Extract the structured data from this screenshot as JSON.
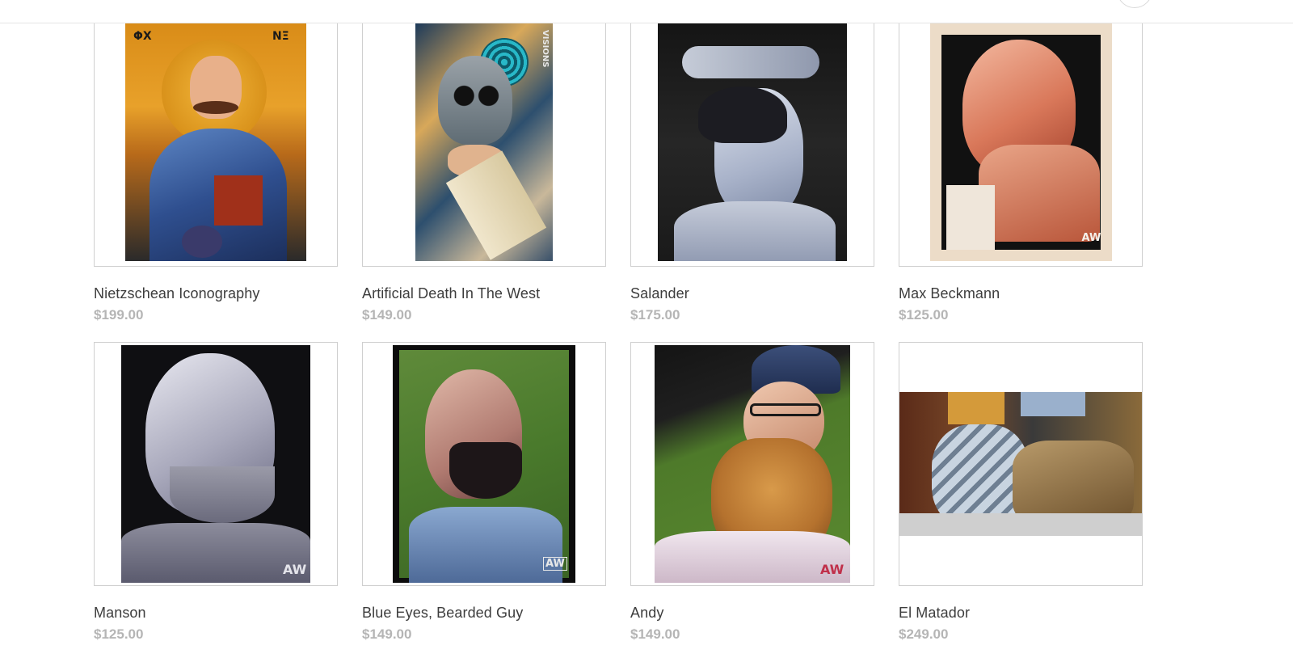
{
  "products": [
    {
      "title": "Nietzschean Iconography",
      "price": "$199.00",
      "image": "portrait-icon-painting"
    },
    {
      "title": "Artificial Death In The West",
      "price": "$149.00",
      "image": "skull-collage"
    },
    {
      "title": "Salander",
      "price": "$175.00",
      "image": "figure-painting"
    },
    {
      "title": "Max Beckmann",
      "price": "$125.00",
      "image": "portrait-painting"
    },
    {
      "title": "Manson",
      "price": "$125.00",
      "image": "portrait-painting"
    },
    {
      "title": "Blue Eyes, Bearded Guy",
      "price": "$149.00",
      "image": "portrait-painting"
    },
    {
      "title": "Andy",
      "price": "$149.00",
      "image": "portrait-painting"
    },
    {
      "title": "El Matador",
      "price": "$249.00",
      "image": "matador-painting"
    }
  ],
  "colors": {
    "title": "#3d3d3d",
    "price": "#b5b5b5",
    "border": "#cfcfcf"
  }
}
